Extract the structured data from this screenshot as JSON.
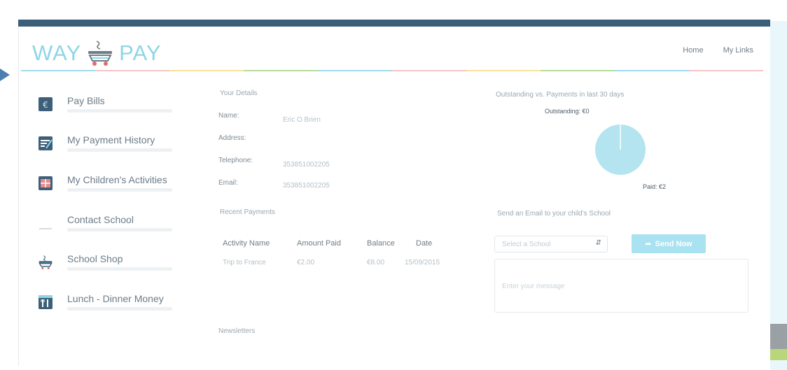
{
  "header": {
    "logo_left": "WAY",
    "logo_right": "PAY",
    "nav": [
      "Home",
      "My Links"
    ]
  },
  "colors": {
    "top_bar": "#3b5f78",
    "logo": "#8ed6e6",
    "button": "#a9e2f0",
    "pie": "#b3e4f0",
    "rule": [
      "#9fdcea",
      "#f3c5c5",
      "#f7e39a",
      "#b8dc9c",
      "#9fdcea",
      "#f3c5c5",
      "#f7e39a",
      "#b8dc9c",
      "#9fdcea",
      "#f3c5c5"
    ]
  },
  "sidebar": {
    "items": [
      {
        "label": "Pay Bills",
        "icon": "euro-icon"
      },
      {
        "label": "My Payment History",
        "icon": "history-icon"
      },
      {
        "label": "My Children's Activities",
        "icon": "activities-icon"
      },
      {
        "label": "Contact School",
        "icon": "contact-icon"
      },
      {
        "label": "School Shop",
        "icon": "cart-icon"
      },
      {
        "label": "Lunch - Dinner Money",
        "icon": "cutlery-icon"
      }
    ]
  },
  "details": {
    "title": "Your Details",
    "name_label": "Name:",
    "name_value": "Eric O Brien",
    "address_label": "Address:",
    "address_value": "",
    "telephone_label": "Telephone:",
    "telephone_value": "353851002205",
    "email_label": "Email:",
    "email_value": "353851002205"
  },
  "payments": {
    "title": "Recent Payments",
    "columns": [
      "Activity Name",
      "Amount Paid",
      "Balance",
      "Date"
    ],
    "rows": [
      [
        "Trip to France",
        "€2.00",
        "€8.00",
        "15/09/2015"
      ]
    ]
  },
  "newsletters": {
    "title": "Newsletters"
  },
  "chart": {
    "title": "Outstanding vs. Payments in last 30 days",
    "outstanding_label": "Outstanding: €0",
    "paid_label": "Paid: €2"
  },
  "chart_data": {
    "type": "pie",
    "categories": [
      "Outstanding",
      "Paid"
    ],
    "values": [
      0,
      2
    ],
    "title": "Outstanding vs. Payments in last 30 days"
  },
  "email": {
    "title": "Send an Email to your child's School",
    "select_placeholder": "Select a School",
    "send_label": "Send Now",
    "message_placeholder": "Enter your message"
  }
}
